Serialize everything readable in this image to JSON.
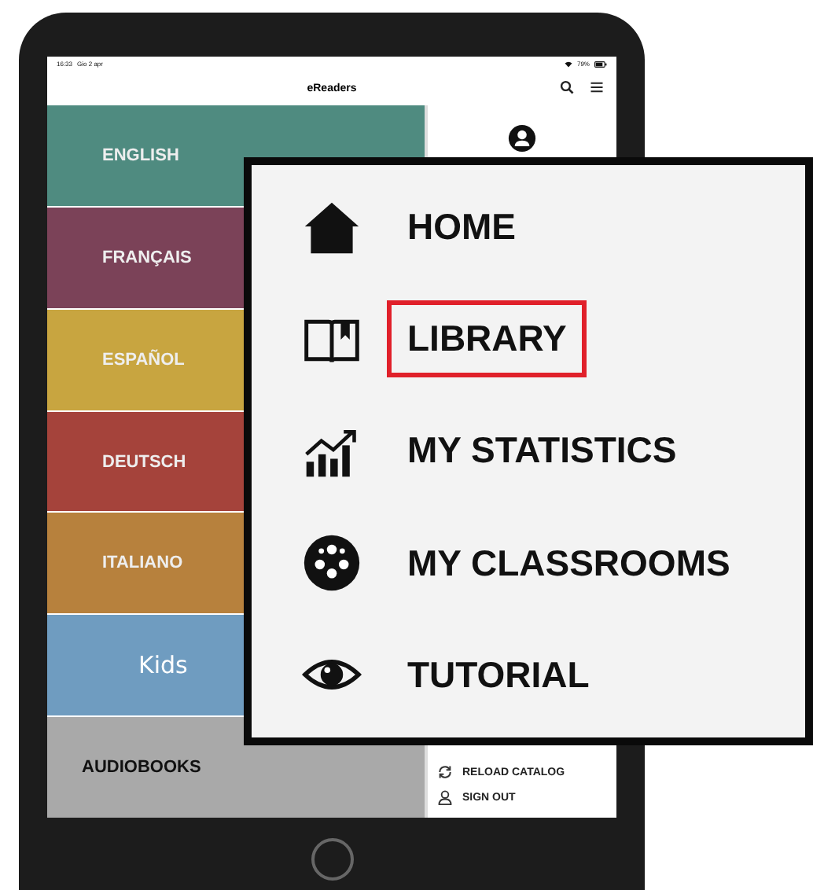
{
  "status_bar": {
    "time": "16:33",
    "date": "Gio 2 apr",
    "battery": "79%"
  },
  "header": {
    "title": "eReaders"
  },
  "categories": [
    {
      "label": "ENGLISH",
      "kind": "language",
      "color": "#4f8b80"
    },
    {
      "label": "FRANÇAIS",
      "kind": "language",
      "color": "#7b4258"
    },
    {
      "label": "ESPAÑOL",
      "kind": "language",
      "color": "#c8a540"
    },
    {
      "label": "DEUTSCH",
      "kind": "language",
      "color": "#a5433b"
    },
    {
      "label": "ITALIANO",
      "kind": "language",
      "color": "#b7813d"
    },
    {
      "label": "Kids",
      "kind": "kids",
      "color": "#6f9cc0"
    },
    {
      "label": "AUDIOBOOKS",
      "kind": "audiobooks",
      "color": "#a9a9a9"
    }
  ],
  "side_menu": {
    "items": [
      {
        "label": "RELOAD CATALOG",
        "kind": "reload"
      },
      {
        "label": "SIGN OUT",
        "kind": "signout"
      }
    ]
  },
  "zoomed_menu": {
    "items": [
      {
        "label": "HOME",
        "kind": "home",
        "selected": false
      },
      {
        "label": "LIBRARY",
        "kind": "library",
        "selected": true
      },
      {
        "label": "MY STATISTICS",
        "kind": "statistics",
        "selected": false
      },
      {
        "label": "MY CLASSROOMS",
        "kind": "classrooms",
        "selected": false
      },
      {
        "label": "TUTORIAL",
        "kind": "tutorial",
        "selected": false
      }
    ]
  }
}
